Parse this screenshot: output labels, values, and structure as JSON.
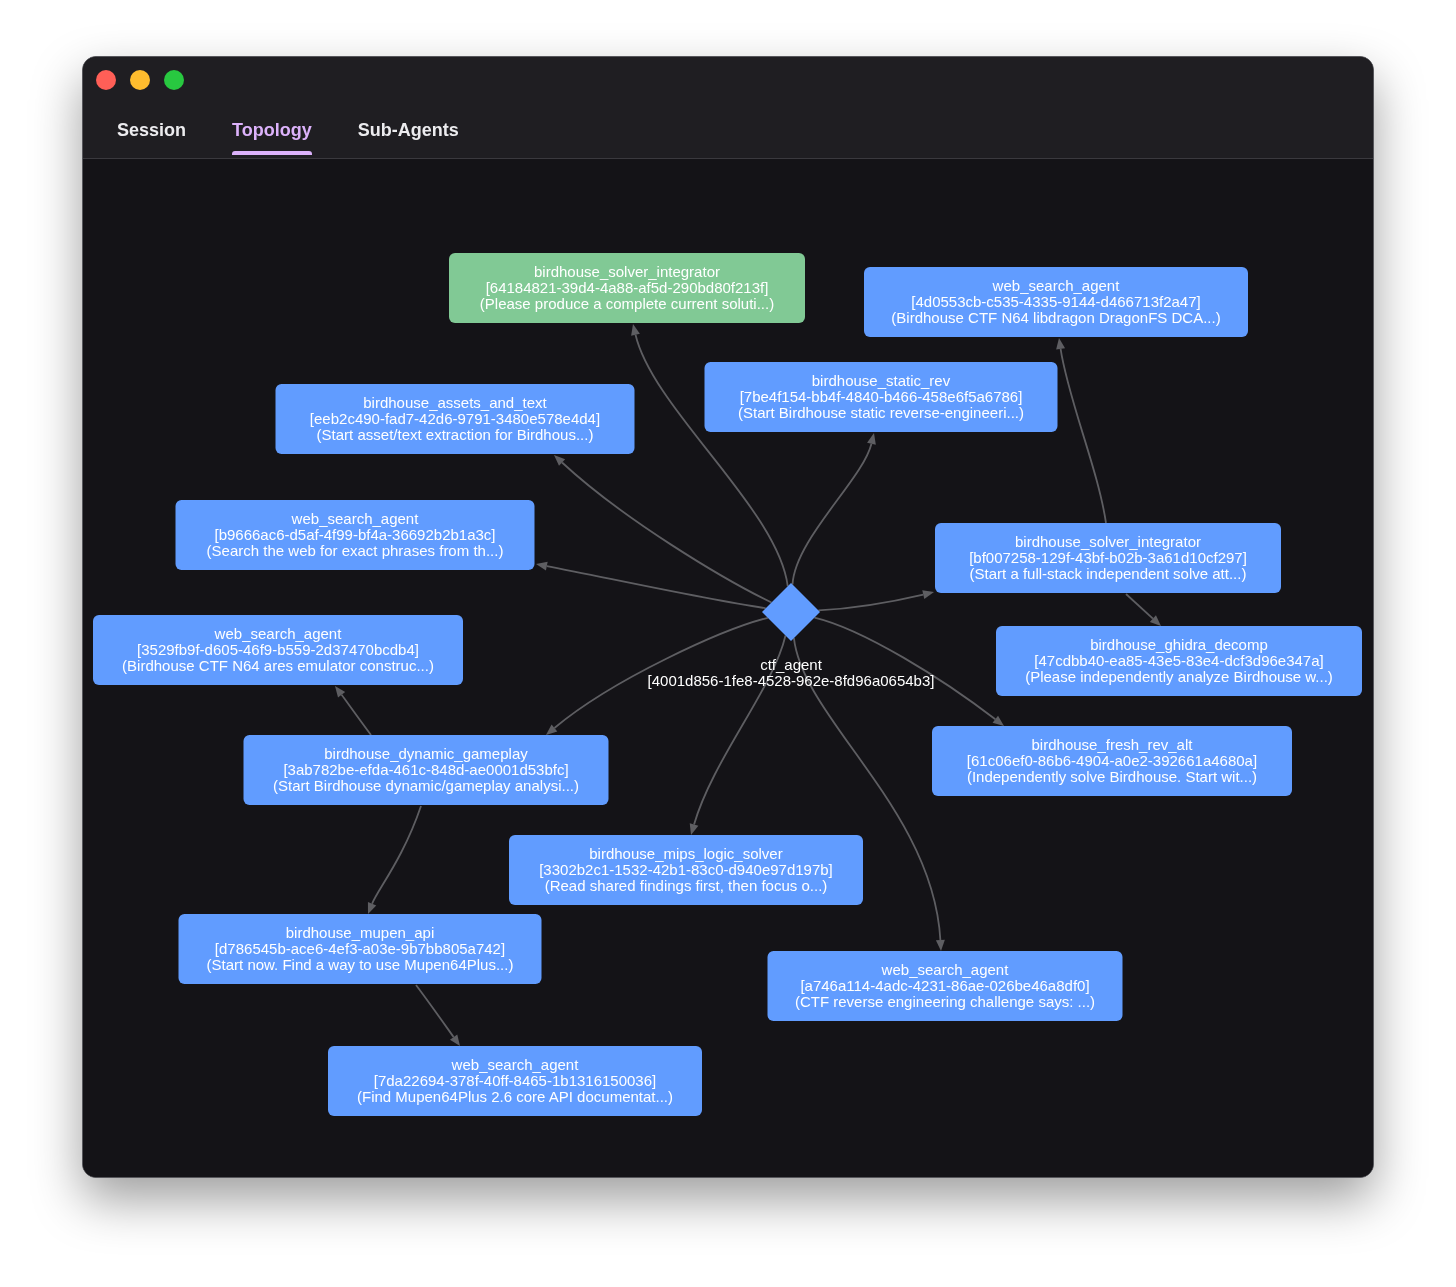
{
  "tabs": [
    {
      "label": "Session",
      "selected": false
    },
    {
      "label": "Topology",
      "selected": true
    },
    {
      "label": "Sub-Agents",
      "selected": false
    }
  ],
  "graph": {
    "root": {
      "title": "ctf_agent",
      "id": "[4001d856-1fe8-4528-962e-8fd96a0654b3]",
      "children": [
        {
          "title": "birdhouse_solver_integrator",
          "id": "[64184821-39d4-4a88-af5d-290bd80f213f]",
          "task": "(Please produce a complete current soluti...)",
          "color": "#81c995"
        },
        {
          "title": "birdhouse_static_rev",
          "id": "[7be4f154-bb4f-4840-b466-458e6f5a6786]",
          "task": "(Start Birdhouse static reverse-engineeri...)",
          "color": "#619cff"
        },
        {
          "title": "birdhouse_assets_and_text",
          "id": "[eeb2c490-fad7-42d6-9791-3480e578e4d4]",
          "task": "(Start asset/text extraction for Birdhous...)",
          "color": "#619cff"
        },
        {
          "title": "web_search_agent",
          "id": "[b9666ac6-d5af-4f99-bf4a-36692b2b1a3c]",
          "task": "(Search the web for exact phrases from th...)",
          "color": "#619cff"
        },
        {
          "title": "birdhouse_solver_integrator",
          "id": "[bf007258-129f-43bf-b02b-3a61d10cf297]",
          "task": "(Start a full-stack independent solve att...)",
          "color": "#619cff",
          "children": [
            {
              "title": "web_search_agent",
              "id": "[4d0553cb-c535-4335-9144-d466713f2a47]",
              "task": "(Birdhouse CTF N64 libdragon DragonFS DCA...)",
              "color": "#619cff"
            },
            {
              "title": "birdhouse_ghidra_decomp",
              "id": "[47cdbb40-ea85-43e5-83e4-dcf3d96e347a]",
              "task": "(Please independently analyze Birdhouse w...)",
              "color": "#619cff"
            }
          ]
        },
        {
          "title": "birdhouse_fresh_rev_alt",
          "id": "[61c06ef0-86b6-4904-a0e2-392661a4680a]",
          "task": "(Independently solve Birdhouse. Start wit...)",
          "color": "#619cff"
        },
        {
          "title": "birdhouse_dynamic_gameplay",
          "id": "[3ab782be-efda-461c-848d-ae0001d53bfc]",
          "task": "(Start Birdhouse dynamic/gameplay analysi...)",
          "color": "#619cff",
          "children": [
            {
              "title": "web_search_agent",
              "id": "[3529fb9f-d605-46f9-b559-2d37470bcdb4]",
              "task": "(Birdhouse CTF N64 ares emulator construc...)",
              "color": "#619cff"
            },
            {
              "title": "birdhouse_mupen_api",
              "id": "[d786545b-ace6-4ef3-a03e-9b7bb805a742]",
              "task": "(Start now. Find a way to use Mupen64Plus...)",
              "color": "#619cff",
              "children": [
                {
                  "title": "web_search_agent",
                  "id": "[7da22694-378f-40ff-8465-1b1316150036]",
                  "task": "(Find Mupen64Plus 2.6 core API documentat...)",
                  "color": "#619cff"
                }
              ]
            }
          ]
        },
        {
          "title": "birdhouse_mips_logic_solver",
          "id": "[3302b2c1-1532-42b1-83c0-d940e97d197b]",
          "task": "(Read shared findings first, then focus o...)",
          "color": "#619cff"
        },
        {
          "title": "web_search_agent",
          "id": "[a746a114-4adc-4231-86ae-026be46a8df0]",
          "task": "(CTF reverse engineering challenge says: ...)",
          "color": "#619cff"
        }
      ]
    }
  }
}
